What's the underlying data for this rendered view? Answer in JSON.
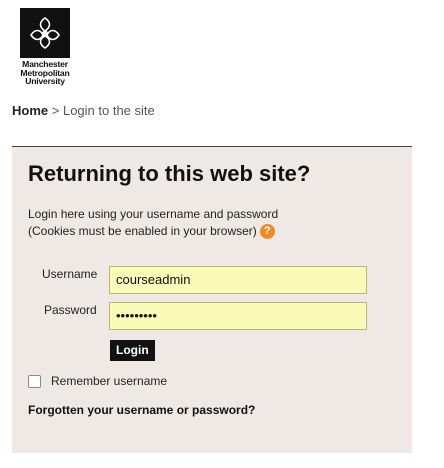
{
  "branding": {
    "logo_lines": [
      "Manchester",
      "Metropolitan",
      "University"
    ]
  },
  "breadcrumb": {
    "home": "Home",
    "separator": ">",
    "current": "Login to the site"
  },
  "login": {
    "title": "Returning to this web site?",
    "intro_line1": "Login here using your username and password",
    "intro_line2": "(Cookies must be enabled in your browser)",
    "help_glyph": "?",
    "username_label": "Username",
    "username_value": "courseadmin",
    "password_label": "Password",
    "password_value": "•••••••••",
    "login_button": "Login",
    "remember_label": "Remember username",
    "forgot_link": "Forgotten your username or password?"
  },
  "colors": {
    "panel_bg": "#efe9e6",
    "input_bg": "#fbfbb8",
    "button_bg": "#111111",
    "help_icon": "#f08a23"
  }
}
